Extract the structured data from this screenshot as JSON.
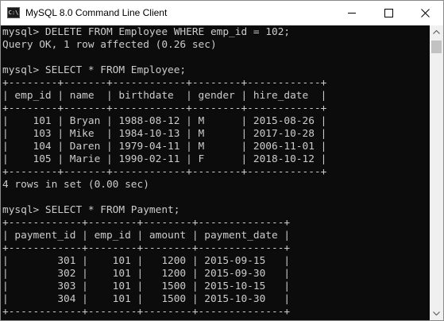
{
  "window": {
    "title": "MySQL 8.0 Command Line Client",
    "icon": "terminal-icon",
    "icon_glyph": "C:\\",
    "controls": {
      "minimize": "minimize-icon",
      "maximize": "maximize-icon",
      "close": "close-icon"
    }
  },
  "colors": {
    "console_background": "#0c0c0c",
    "console_text": "#cccccc",
    "titlebar_background": "#ffffff"
  },
  "console": {
    "lines": [
      "mysql> DELETE FROM Employee WHERE emp_id = 102;",
      "Query OK, 1 row affected (0.26 sec)",
      "",
      "mysql> SELECT * FROM Employee;",
      "+--------+-------+------------+--------+------------+",
      "| emp_id | name  | birthdate  | gender | hire_date  |",
      "+--------+-------+------------+--------+------------+",
      "|    101 | Bryan | 1988-08-12 | M      | 2015-08-26 |",
      "|    103 | Mike  | 1984-10-13 | M      | 2017-10-28 |",
      "|    104 | Daren | 1979-04-11 | M      | 2006-11-01 |",
      "|    105 | Marie | 1990-02-11 | F      | 2018-10-12 |",
      "+--------+-------+------------+--------+------------+",
      "4 rows in set (0.00 sec)",
      "",
      "mysql> SELECT * FROM Payment;",
      "+------------+--------+--------+--------------+",
      "| payment_id | emp_id | amount | payment_date |",
      "+------------+--------+--------+--------------+",
      "|        301 |    101 |   1200 | 2015-09-15   |",
      "|        302 |    101 |   1200 | 2015-09-30   |",
      "|        303 |    101 |   1500 | 2015-10-15   |",
      "|        304 |    101 |   1500 | 2015-10-30   |",
      "+------------+--------+--------+--------------+"
    ]
  },
  "scrollbar": {
    "up_icon": "scroll-up-arrow-icon",
    "down_icon": "scroll-down-arrow-icon"
  }
}
